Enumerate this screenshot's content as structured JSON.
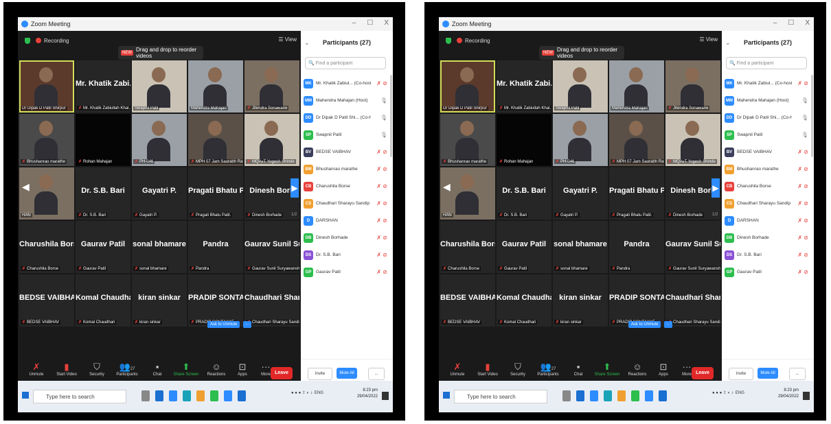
{
  "window": {
    "title": "Zoom Meeting",
    "controls": [
      "–",
      "☐",
      "X"
    ]
  },
  "topbar": {
    "recording": "Recording",
    "view": "View",
    "toast_badge": "NEW",
    "toast_text": "Drag and drop to reorder videos"
  },
  "tiles": [
    {
      "label": "Dr Dipak D Patil Shirpur",
      "big": "",
      "type": "cam-c1",
      "selected": true
    },
    {
      "label": "Mr. Khatik Zabiullah Khal...",
      "big": "Mr. Khatik Zabi...",
      "type": "name"
    },
    {
      "label": "Swapnil Patil",
      "big": "",
      "type": "cam-c3"
    },
    {
      "label": "Mahendra Mahajan",
      "big": "",
      "type": "cam-c2"
    },
    {
      "label": "Jitendra Sonawane",
      "big": "",
      "type": "cam-c4"
    },
    {
      "label": "Bhushanrao marathe",
      "big": "",
      "type": "cam"
    },
    {
      "label": "Rohan Mahajan",
      "big": "",
      "type": "black"
    },
    {
      "label": "PH-046",
      "big": "",
      "type": "cam-c2"
    },
    {
      "label": "MPH 07 Jam Saurabh Ras...",
      "big": "",
      "type": "cam-c5"
    },
    {
      "label": "MQAvT Yogesh Shinde",
      "big": "",
      "type": "cam-c3"
    },
    {
      "label": "HAN",
      "big": "",
      "type": "cam-c4"
    },
    {
      "label": "Dr. S.B. Bari",
      "big": "Dr. S.B. Bari",
      "type": "name"
    },
    {
      "label": "Gayatri P.",
      "big": "Gayatri P.",
      "type": "name"
    },
    {
      "label": "Pragati Bhatu Patil.",
      "big": "Pragati Bhatu P...",
      "type": "name"
    },
    {
      "label": "Dinesh Borhade",
      "big": "Dinesh Borh",
      "type": "name"
    },
    {
      "label": "Charushila Borse",
      "big": "Charushila Borse",
      "type": "name"
    },
    {
      "label": "Gaurav Patil",
      "big": "Gaurav Patil",
      "type": "name"
    },
    {
      "label": "sonal bhamare",
      "big": "sonal bhamare",
      "type": "name"
    },
    {
      "label": "Pandra",
      "big": "Pandra",
      "type": "name"
    },
    {
      "label": "Gaurav Sunil Suryawanshi",
      "big": "Gaurav Sunil Su...",
      "type": "name"
    },
    {
      "label": "BEDSE VAIBHAV",
      "big": "BEDSE VAIBHAV",
      "type": "name"
    },
    {
      "label": "Komal Chaudhari",
      "big": "Komal Chaudhari",
      "type": "name"
    },
    {
      "label": "kiran sinkar",
      "big": "kiran sinkar",
      "type": "name"
    },
    {
      "label": "PRADIP SONTAKKE",
      "big": "PRADIP SONTA...",
      "type": "name"
    },
    {
      "label": "Chaudhari Sharayu Sandip",
      "big": "Chaudhari Shar...",
      "type": "name"
    }
  ],
  "pagination": {
    "left": "1/2",
    "right": "1/2"
  },
  "ask_unmute": "Ask to Unmute",
  "toolbar": {
    "unmute": "Unmute",
    "start_video": "Start Video",
    "security": "Security",
    "participants": "Participants",
    "participants_count": "27",
    "chat": "Chat",
    "share_screen": "Share Screen",
    "reactions": "Reactions",
    "apps": "Apps",
    "more": "More",
    "leave": "Leave"
  },
  "panel": {
    "title": "Participants (27)",
    "search_placeholder": "Find a participant",
    "invite": "Invite",
    "mute_all": "Mute All",
    "more": "...",
    "participants": [
      {
        "initials": "MK",
        "name": "Mr. Khatik Zabiul... (Co-host, me)",
        "color": "#2d8cff",
        "icon": "mic-off"
      },
      {
        "initials": "MM",
        "name": "Mahendra Mahajan (Host)",
        "color": "#2d8cff",
        "icon": "mic-on"
      },
      {
        "initials": "DD",
        "name": "Dr Dipak D Patil Shi... (Co-host)",
        "color": "#2d8cff",
        "icon": "mic-on"
      },
      {
        "initials": "SP",
        "name": "Swapnil Patil",
        "color": "#2dbe4e",
        "icon": "mic-on"
      },
      {
        "initials": "BV",
        "name": "BEDSE VAIBHAV",
        "color": "#3b3f5c",
        "icon": "mic-off"
      },
      {
        "initials": "BM",
        "name": "Bhushanrao marathe",
        "color": "#f0a030",
        "icon": "mic-off"
      },
      {
        "initials": "CB",
        "name": "Charushila Borse",
        "color": "#e8413b",
        "icon": "mic-off"
      },
      {
        "initials": "CS",
        "name": "Chaudhari Sharayu Sandip",
        "color": "#f0a030",
        "icon": "mic-off"
      },
      {
        "initials": "D",
        "name": "DARSHAN",
        "color": "#2d8cff",
        "icon": "mic-off"
      },
      {
        "initials": "DB",
        "name": "Dinesh Borhade",
        "color": "#2dbe4e",
        "icon": "mic-off"
      },
      {
        "initials": "DS",
        "name": "Dr. S.B. Bari",
        "color": "#8b52d6",
        "icon": "mic-off"
      },
      {
        "initials": "GP",
        "name": "Gaurav Patil",
        "color": "#2dbe4e",
        "icon": "mic-off"
      }
    ]
  },
  "taskbar": {
    "search": "Type here to search",
    "time": "8:23 pm",
    "date": "29/04/2022",
    "lang": "ENG"
  }
}
